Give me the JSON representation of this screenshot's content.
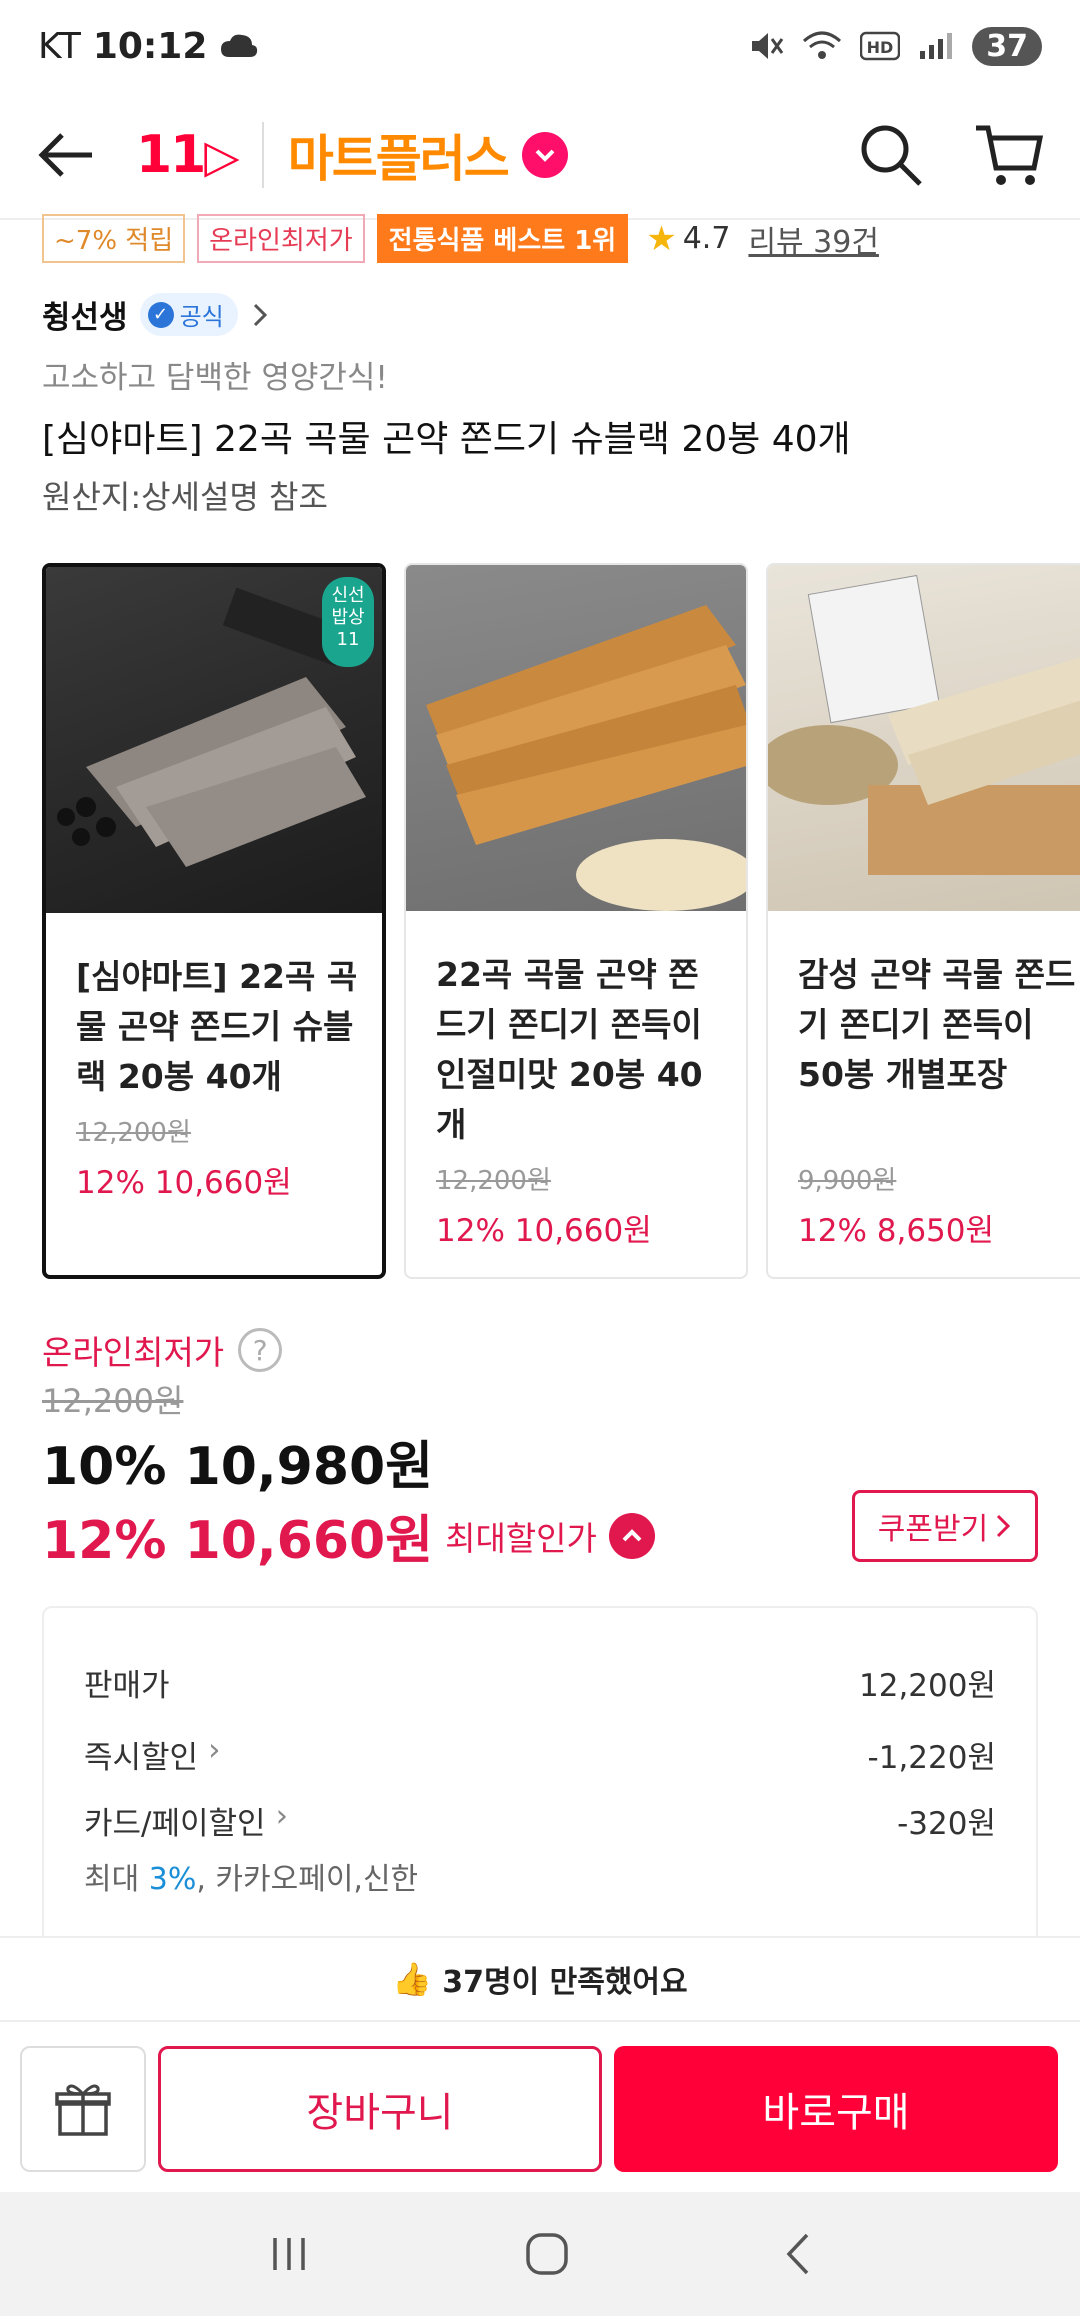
{
  "status": {
    "carrier": "KT",
    "time": "10:12",
    "battery": "37"
  },
  "header": {
    "brand_11": "11",
    "brand_mart": "마트플러스"
  },
  "tags": {
    "points": "~7% 적립",
    "lowest": "온라인최저가",
    "best": "전통식품 베스트 1위",
    "rating": "4.7",
    "reviews": "리뷰 39건"
  },
  "seller": {
    "name": "췽선생",
    "official": "공식"
  },
  "product": {
    "subtitle": "고소하고 담백한 영양간식!",
    "title": "[심야마트] 22곡 곡물 곤약 쫀드기 슈블랙 20봉 40개",
    "origin": "원산지:상세설명 참조"
  },
  "carousel": [
    {
      "name": "[심야마트] 22곡 곡물 곤약 쫀드기 슈블랙 20봉 40개",
      "orig": "12,200원",
      "sale": "12% 10,660원",
      "chip": "신선 밥상 11"
    },
    {
      "name": "22곡 곡물 곤약 쫀드기 쫀디기 쫀득이 인절미맛 20봉 40개",
      "orig": "12,200원",
      "sale": "12% 10,660원"
    },
    {
      "name": "감성 곤약 곡물 쫀드기 쫀디기 쫀득이 50봉 개별포장",
      "orig": "9,900원",
      "sale": "12% 8,650원"
    }
  ],
  "price": {
    "lowest_label": "온라인최저가",
    "original": "12,200원",
    "discounted": "10% 10,980원",
    "best": "12% 10,660원",
    "best_label": "최대할인가",
    "coupon": "쿠폰받기"
  },
  "breakdown": {
    "sale_label": "판매가",
    "sale_value": "12,200원",
    "instant_label": "즉시할인",
    "instant_value": "-1,220원",
    "card_label": "카드/페이할인",
    "card_value": "-320원",
    "note_prefix": "최대 ",
    "note_pct": "3%",
    "note_suffix": ", 카카오페이,신한"
  },
  "satisfy": "37명이 만족했어요",
  "bottom": {
    "cart": "장바구니",
    "buy": "바로구매"
  },
  "colors": {
    "accent": "#ff0038",
    "sale": "#e0184e",
    "brand_orange": "#ff8a00"
  }
}
